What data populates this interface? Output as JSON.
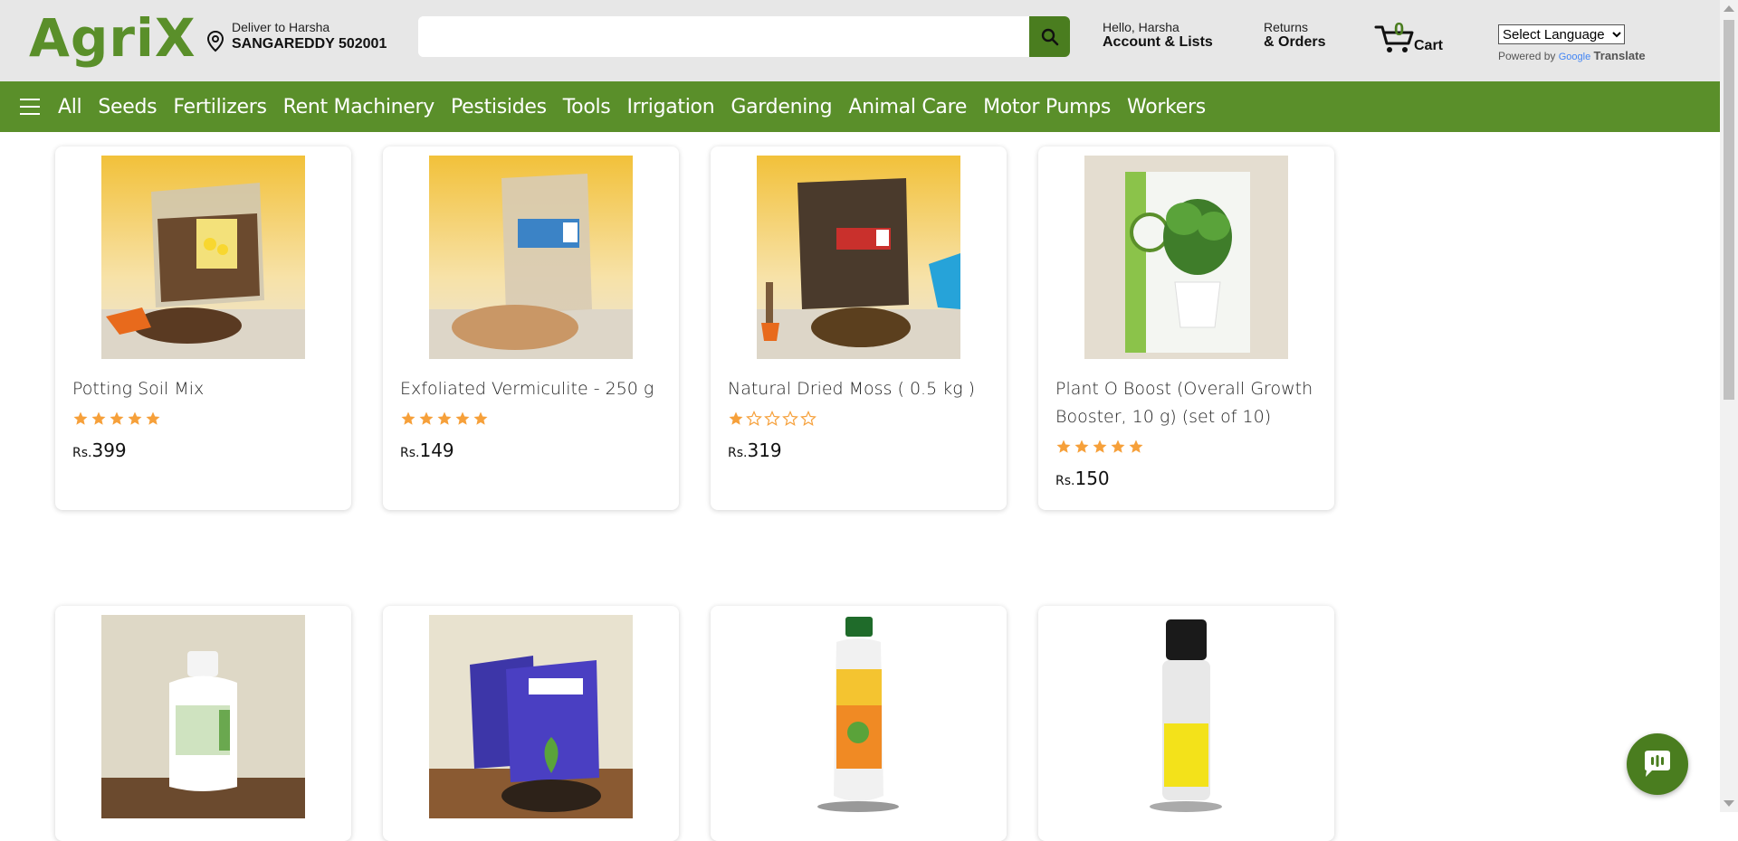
{
  "header": {
    "logo": "AgriX",
    "deliver_line1": "Deliver to Harsha",
    "deliver_line2": "SANGAREDDY 502001",
    "search_value": "",
    "search_placeholder": "",
    "account_line1": "Hello, Harsha",
    "account_line2": "Account & Lists",
    "orders_line1": "Returns",
    "orders_line2": "& Orders",
    "cart_count": "0",
    "cart_label": "Cart",
    "language_selected": "Select Language",
    "powered_by": "Powered by",
    "google": "Google",
    "translate": "Translate"
  },
  "nav": {
    "items": [
      "All",
      "Seeds",
      "Fertilizers",
      "Rent Machinery",
      "Pestisides",
      "Tools",
      "Irrigation",
      "Gardening",
      "Animal Care",
      "Motor Pumps",
      "Workers"
    ]
  },
  "products": [
    {
      "name": "Potting Soil Mix",
      "rating": 5,
      "currency": "Rs.",
      "price": "399",
      "icon": "soil-bag"
    },
    {
      "name": "Exfoliated Vermiculite - 250 g",
      "rating": 5,
      "currency": "Rs.",
      "price": "149",
      "icon": "vermiculite-bag"
    },
    {
      "name": "Natural Dried Moss ( 0.5 kg )",
      "rating": 1,
      "currency": "Rs.",
      "price": "319",
      "icon": "moss-bag"
    },
    {
      "name": "Plant O Boost (Overall Growth Booster, 10 g) (set of 10)",
      "rating": 5,
      "currency": "Rs.",
      "price": "150",
      "icon": "plant-box"
    },
    {
      "name": "",
      "icon": "jeevamrut-bottle"
    },
    {
      "name": "",
      "icon": "fertilizer-bags"
    },
    {
      "name": "",
      "icon": "mega-nutri-bottle"
    },
    {
      "name": "",
      "icon": "growth-power-vial"
    }
  ],
  "colors": {
    "brand_green": "#5a8f2a",
    "dark_green": "#4a7d1f",
    "star": "#f6a03a"
  }
}
